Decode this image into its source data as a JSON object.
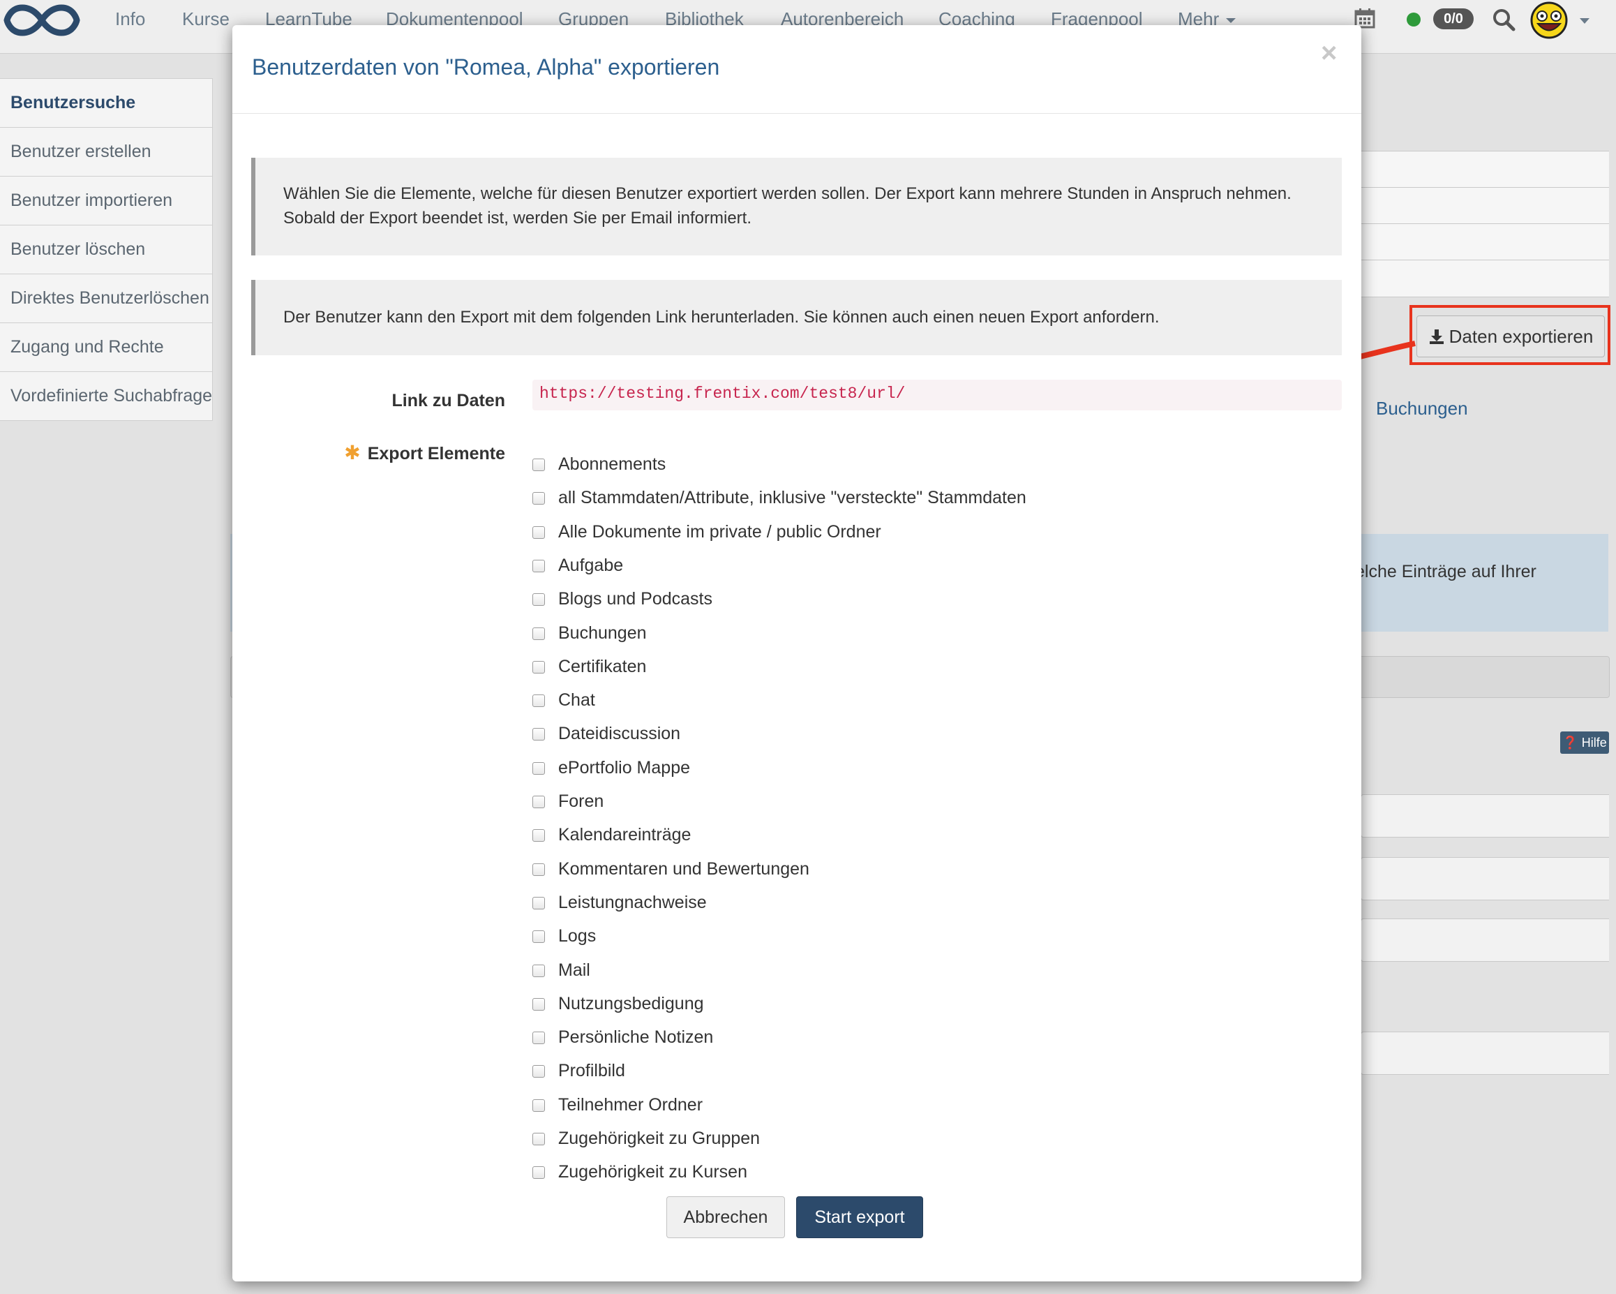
{
  "topnav": {
    "items": [
      "Info",
      "Kurse",
      "LearnTube",
      "Dokumentenpool",
      "Gruppen",
      "Bibliothek",
      "Autorenbereich",
      "Coaching",
      "Fragenpool",
      "Mehr"
    ],
    "counter": "0/0"
  },
  "sidebar": {
    "items": [
      "Benutzersuche",
      "Benutzer erstellen",
      "Benutzer importieren",
      "Benutzer löschen",
      "Direktes Benutzerlöschen",
      "Zugang und Rechte",
      "Vordefinierte Suchabfrage"
    ]
  },
  "background": {
    "export_button": "Daten exportieren",
    "link": "Buchungen",
    "info_text": "elche Einträge auf Ihrer",
    "help": "Hilfe"
  },
  "modal": {
    "title": "Benutzerdaten von \"Romea, Alpha\" exportieren",
    "close": "×",
    "note1": "Wählen Sie die Elemente, welche für diesen Benutzer exportiert werden sollen. Der Export kann mehrere Stunden in Anspruch nehmen. Sobald der Export beendet ist, werden Sie per Email informiert.",
    "note2": "Der Benutzer kann den Export mit dem folgenden Link herunterladen. Sie können auch einen neuen Export anfordern.",
    "link_label": "Link zu Daten",
    "link_value": "https://testing.frentix.com/test8/url/",
    "elements_label": "Export Elemente",
    "elements": [
      "Abonnements",
      "all Stammdaten/Attribute, inklusive \"versteckte\" Stammdaten",
      "Alle Dokumente im private / public Ordner",
      "Aufgabe",
      "Blogs und Podcasts",
      "Buchungen",
      "Certifikaten",
      "Chat",
      "Dateidiscussion",
      "ePortfolio Mappe",
      "Foren",
      "Kalendareinträge",
      "Kommentaren und Bewertungen",
      "Leistungnachweise",
      "Logs",
      "Mail",
      "Nutzungsbedigung",
      "Persönliche Notizen",
      "Profilbild",
      "Teilnehmer Ordner",
      "Zugehörigkeit zu Gruppen",
      "Zugehörigkeit zu Kursen"
    ],
    "cancel_label": "Abbrechen",
    "start_label": "Start export"
  }
}
